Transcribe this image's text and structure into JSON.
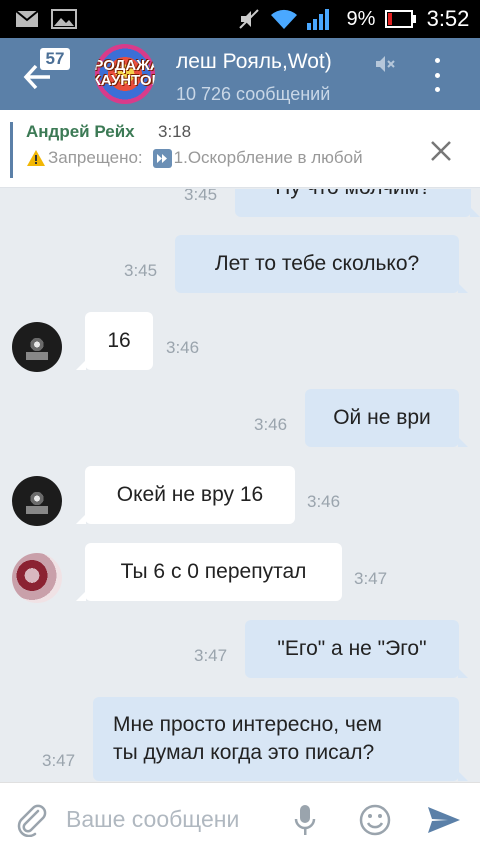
{
  "status_bar": {
    "battery_percent": "9%",
    "clock": "3:52"
  },
  "header": {
    "unread_count": "57",
    "avatar_label": "РОДАЖА\nКАУНТОВ",
    "title": "леш Рояль,Wot)",
    "subtitle": "10 726 сообщений"
  },
  "pinned": {
    "author": "Андрей Рейх",
    "time": "3:18",
    "text": "Запрещено:",
    "text_rest": "1.Оскорбление в любой"
  },
  "messages": [
    {
      "direction": "out",
      "text": "Ну что молчим?",
      "time": "3:45"
    },
    {
      "direction": "out",
      "text": "Лет то тебе сколько?",
      "time": "3:45"
    },
    {
      "direction": "in",
      "avatar": "tank",
      "text": "16",
      "time": "3:46"
    },
    {
      "direction": "out",
      "text": "Ой не ври",
      "time": "3:46"
    },
    {
      "direction": "in",
      "avatar": "tank",
      "text": "Окей не вру 16",
      "time": "3:46"
    },
    {
      "direction": "in",
      "avatar": "rose",
      "text": "Ты 6 с 0 перепутал",
      "time": "3:47"
    },
    {
      "direction": "out",
      "text": "\"Его\" а не \"Эго\"",
      "time": "3:47"
    },
    {
      "direction": "out",
      "text_line1": "Мне просто интересно, чем",
      "text_line2": "ты думал когда это писал?",
      "time": "3:47"
    }
  ],
  "input": {
    "placeholder": "Ваше сообщени"
  },
  "colors": {
    "header": "#5b80a8",
    "outgoing_bubble": "#d8e6f5",
    "incoming_bubble": "#ffffff",
    "background": "#e8ecf0"
  }
}
